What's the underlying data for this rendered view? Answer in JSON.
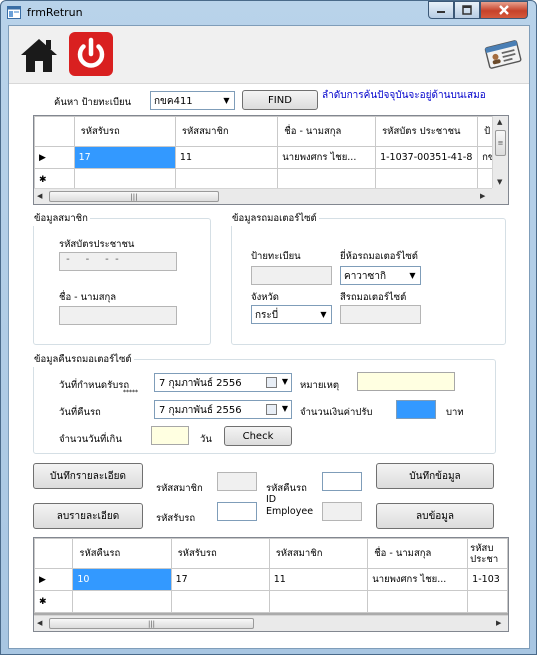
{
  "window": {
    "title": "frmRetrun"
  },
  "search": {
    "label": "ค้นหา ป้ายทะเบียน",
    "value": "กขค411",
    "find_label": "FIND",
    "hint": "ลำดับการค้นปัจจุบันจะอยู่ด้านบนเสมอ"
  },
  "grid1": {
    "columns": [
      "รหัสรับรถ",
      "รหัสสมาชิก",
      "ชื่อ - นามสกุล",
      "รหัสบัตร ประชาชน",
      "ป้"
    ],
    "rows": [
      {
        "cells": [
          "17",
          "11",
          "นายพงศกร ไชย...",
          "1-1037-00351-41-8",
          "กข"
        ]
      }
    ],
    "row_marker": "▶",
    "new_marker": "✱"
  },
  "member": {
    "title": "ข้อมูลสมาชิก",
    "id_card_label": "รหัสบัตรประชาชน",
    "id_card_value": " -     -     -  -",
    "name_label": "ชื่อ - นามสกุล",
    "name_value": ""
  },
  "moto": {
    "title": "ข้อมูลรถมอเตอร์ไซต์",
    "plate_label": "ป้ายทะเบียน",
    "plate_value": "",
    "brand_label": "ยี่ห้อรถมอเตอร์ไซต์",
    "brand_value": "คาวาซากิ",
    "province_label": "จังหวัด",
    "province_value": "กระบี่",
    "color_label": "สีรถมอเตอร์ไซต์",
    "color_value": ""
  },
  "return_info": {
    "title": "ข้อมูลคืนรถมอเตอร์ไซต์",
    "due_label": "วันที่กำหนดรับรถ",
    "due_marker": "*****",
    "due_value": "7  กุมภาพันธ์   2556",
    "return_label": "วันที่คืนรถ",
    "return_value": "7  กุมภาพันธ์   2556",
    "note_label": "หมายเหตุ",
    "note_value": "",
    "fine_label": "จำนวนเงินค่าปรับ",
    "fine_value": "",
    "currency": "บาท",
    "overdue_label": "จำนวนวันที่เกิน",
    "overdue_value": "",
    "day_unit": "วัน",
    "check_label": "Check"
  },
  "actions": {
    "save_detail": "บันทึกรายละเอียด",
    "delete_detail": "ลบรายละเอียด",
    "member_id_label": "รหัสสมาชิก",
    "rent_id_label": "รหัสรับรถ",
    "return_id_label": "รหัสคืนรถ",
    "employee_id_label": "ID Employee",
    "save_data": "บันทึกข้อมูล",
    "delete_data": "ลบข้อมูล"
  },
  "grid2": {
    "columns": [
      "รหัสคืนรถ",
      "รหัสรับรถ",
      "รหัสสมาชิก",
      "ชื่อ - นามสกุล",
      "รหัสบ ประชา"
    ],
    "rows": [
      {
        "cells": [
          "10",
          "17",
          "11",
          "นายพงศกร ไชย...",
          "1-103"
        ]
      }
    ],
    "row_marker": "▶",
    "new_marker": "✱"
  },
  "colors": {
    "selection": "#3399ff",
    "hint_text": "#0000cc",
    "power_button": "#d92020"
  }
}
